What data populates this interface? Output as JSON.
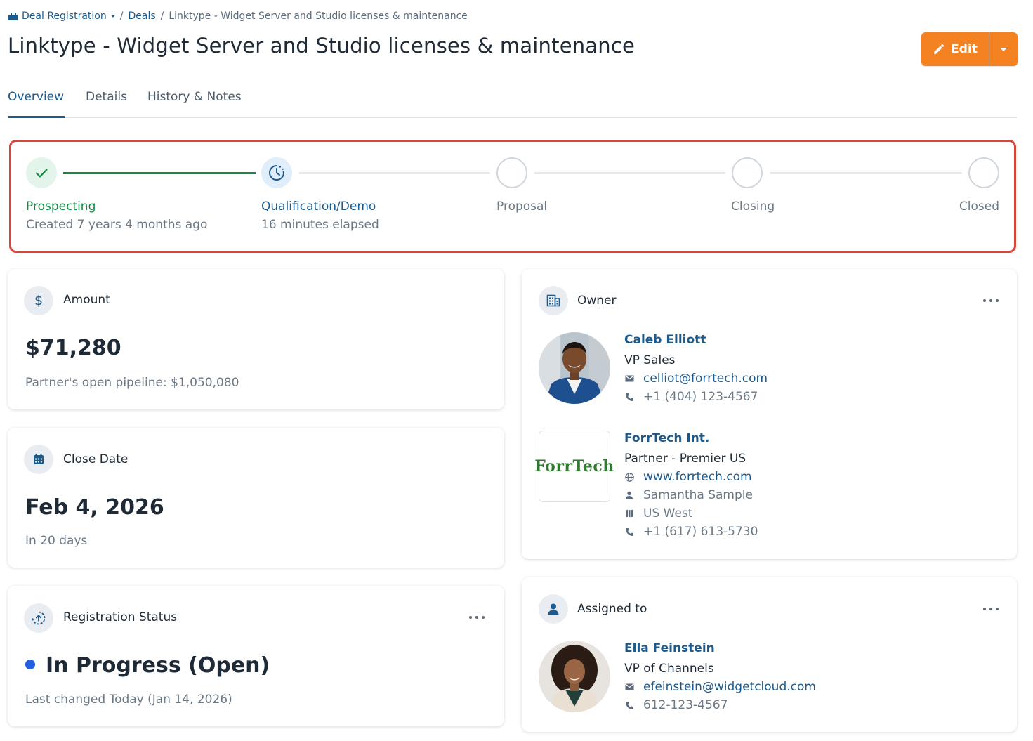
{
  "breadcrumb": {
    "root": "Deal Registration",
    "deals": "Deals",
    "current": "Linktype - Widget Server and Studio licenses & maintenance",
    "separator": "/"
  },
  "page_title": "Linktype - Widget Server and Studio licenses & maintenance",
  "edit_button": {
    "label": "Edit",
    "accent": "#f58220"
  },
  "tabs": [
    {
      "label": "Overview",
      "active": true
    },
    {
      "label": "Details",
      "active": false
    },
    {
      "label": "History & Notes",
      "active": false
    }
  ],
  "stages": [
    {
      "name": "Prospecting",
      "sub": "Created 7 years 4 months ago",
      "state": "complete",
      "icon": "check-icon"
    },
    {
      "name": "Qualification/Demo",
      "sub": "16 minutes elapsed",
      "state": "current",
      "icon": "clock-progress-icon"
    },
    {
      "name": "Proposal",
      "sub": "",
      "state": "pending"
    },
    {
      "name": "Closing",
      "sub": "",
      "state": "pending"
    },
    {
      "name": "Closed",
      "sub": "",
      "state": "pending"
    }
  ],
  "amount_card": {
    "label": "Amount",
    "value": "$71,280",
    "sub": "Partner's open pipeline: $1,050,080",
    "icon": "dollar-icon"
  },
  "close_date_card": {
    "label": "Close Date",
    "value": "Feb 4, 2026",
    "sub": "In 20 days",
    "icon": "calendar-icon"
  },
  "registration_card": {
    "label": "Registration Status",
    "value": "In Progress (Open)",
    "sub": "Last changed Today (Jan 14, 2026)",
    "status_color": "#1f5fe0",
    "icon": "registration-status-icon"
  },
  "owner_card": {
    "label": "Owner",
    "icon": "building-icon",
    "person": {
      "name": "Caleb Elliott",
      "title": "VP Sales",
      "email": "celliot@forrtech.com",
      "phone": "+1 (404) 123-4567"
    },
    "company": {
      "logo_text": "ForrTech",
      "name": "ForrTech Int.",
      "tier": "Partner - Premier US",
      "website": "www.forrtech.com",
      "contact": "Samantha Sample",
      "region": "US West",
      "phone": "+1 (617) 613-5730"
    }
  },
  "assigned_card": {
    "label": "Assigned to",
    "icon": "person-icon",
    "person": {
      "name": "Ella Feinstein",
      "title": "VP of Channels",
      "email": "efeinstein@widgetcloud.com",
      "phone": "612-123-4567"
    }
  },
  "colors": {
    "link": "#1d5a8c",
    "success": "#138a42",
    "highlight_border": "#d9453b"
  }
}
